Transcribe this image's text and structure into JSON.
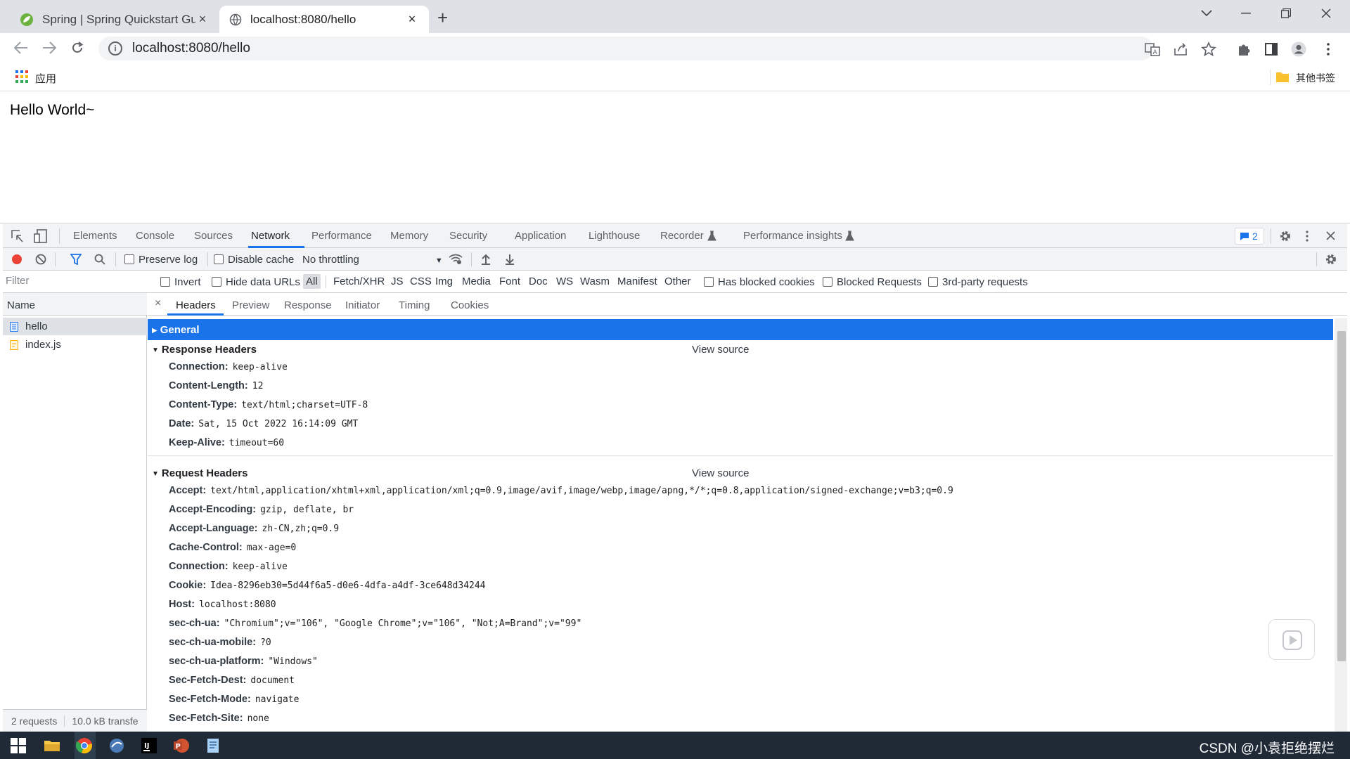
{
  "browser": {
    "tabs": [
      {
        "title": "Spring | Spring Quickstart Gui",
        "close": "×"
      },
      {
        "title": "localhost:8080/hello",
        "close": "×"
      }
    ],
    "new_tab": "+",
    "url": "localhost:8080/hello",
    "bookmarks": {
      "apps_label": "应用",
      "other_bookmarks": "其他书签"
    }
  },
  "page": {
    "content_text": "Hello World~"
  },
  "devtools": {
    "tabs": [
      "Elements",
      "Console",
      "Sources",
      "Network",
      "Performance",
      "Memory",
      "Security",
      "Application",
      "Lighthouse",
      "Recorder",
      "Performance insights"
    ],
    "selected_tab": "Network",
    "issues_count": "2",
    "network_toolbar": {
      "preserve_log": "Preserve log",
      "disable_cache": "Disable cache",
      "throttling": "No throttling"
    },
    "filter_bar": {
      "filter_placeholder": "Filter",
      "invert": "Invert",
      "hide_data_urls": "Hide data URLs",
      "types": [
        "All",
        "Fetch/XHR",
        "JS",
        "CSS",
        "Img",
        "Media",
        "Font",
        "Doc",
        "WS",
        "Wasm",
        "Manifest",
        "Other"
      ],
      "has_blocked_cookies": "Has blocked cookies",
      "blocked_requests": "Blocked Requests",
      "third_party": "3rd-party requests"
    },
    "requests": {
      "column_name": "Name",
      "items": [
        {
          "name": "hello",
          "selected": true
        },
        {
          "name": "index.js",
          "selected": false
        }
      ],
      "status": "2 requests",
      "transfer": "10.0 kB transfe"
    },
    "detail": {
      "close": "×",
      "tabs": [
        "Headers",
        "Preview",
        "Response",
        "Initiator",
        "Timing",
        "Cookies"
      ],
      "selected_tab": "Headers",
      "general": "General",
      "response_headers": {
        "title": "Response Headers",
        "view_source": "View source",
        "rows": [
          {
            "k": "Connection:",
            "v": "keep-alive"
          },
          {
            "k": "Content-Length:",
            "v": "12"
          },
          {
            "k": "Content-Type:",
            "v": "text/html;charset=UTF-8"
          },
          {
            "k": "Date:",
            "v": "Sat, 15 Oct 2022 16:14:09 GMT"
          },
          {
            "k": "Keep-Alive:",
            "v": "timeout=60"
          }
        ]
      },
      "request_headers": {
        "title": "Request Headers",
        "view_source": "View source",
        "rows": [
          {
            "k": "Accept:",
            "v": "text/html,application/xhtml+xml,application/xml;q=0.9,image/avif,image/webp,image/apng,*/*;q=0.8,application/signed-exchange;v=b3;q=0.9"
          },
          {
            "k": "Accept-Encoding:",
            "v": "gzip, deflate, br"
          },
          {
            "k": "Accept-Language:",
            "v": "zh-CN,zh;q=0.9"
          },
          {
            "k": "Cache-Control:",
            "v": "max-age=0"
          },
          {
            "k": "Connection:",
            "v": "keep-alive"
          },
          {
            "k": "Cookie:",
            "v": "Idea-8296eb30=5d44f6a5-d0e6-4dfa-a4df-3ce648d34244"
          },
          {
            "k": "Host:",
            "v": "localhost:8080"
          },
          {
            "k": "sec-ch-ua:",
            "v": "\"Chromium\";v=\"106\", \"Google Chrome\";v=\"106\", \"Not;A=Brand\";v=\"99\""
          },
          {
            "k": "sec-ch-ua-mobile:",
            "v": "?0"
          },
          {
            "k": "sec-ch-ua-platform:",
            "v": "\"Windows\""
          },
          {
            "k": "Sec-Fetch-Dest:",
            "v": "document"
          },
          {
            "k": "Sec-Fetch-Mode:",
            "v": "navigate"
          },
          {
            "k": "Sec-Fetch-Site:",
            "v": "none"
          }
        ]
      }
    }
  },
  "taskbar": {
    "watermark": "CSDN @小袁拒绝摆烂"
  },
  "colors": {
    "accent": "#1a73e8",
    "record": "#ea4335",
    "taskbar": "#1f2a36"
  }
}
